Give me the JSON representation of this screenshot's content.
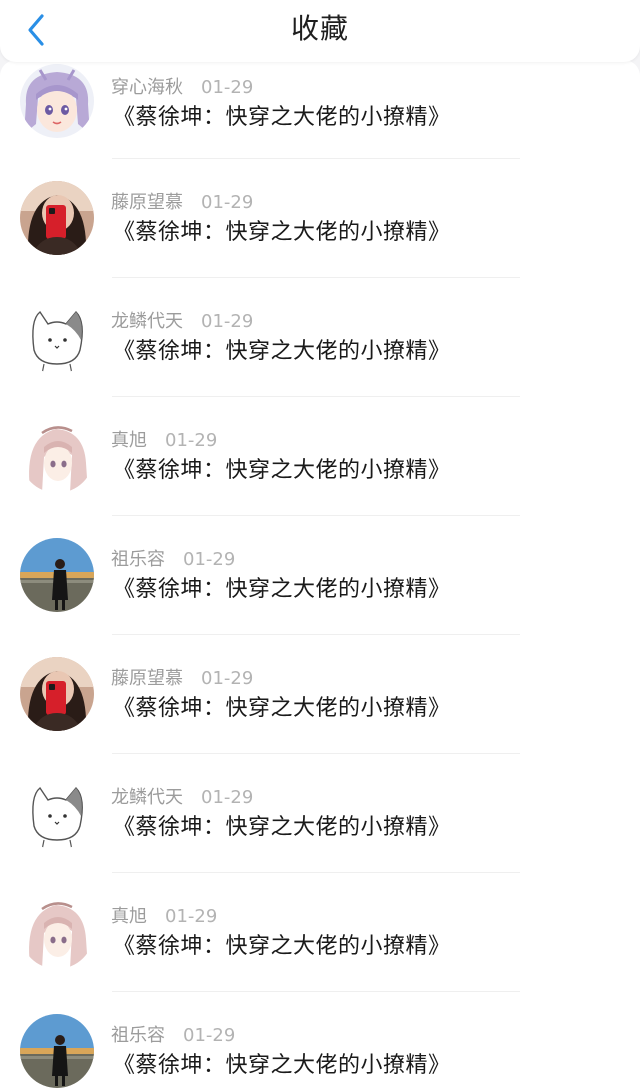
{
  "header": {
    "title": "收藏"
  },
  "items": [
    {
      "username": "穿心海秋",
      "date": "01-29",
      "post": "《蔡徐坤：快穿之大佬的小撩精》",
      "avatar": "anime-purple-hair"
    },
    {
      "username": "藤原望慕",
      "date": "01-29",
      "post": "《蔡徐坤：快穿之大佬的小撩精》",
      "avatar": "selfie-red-phone"
    },
    {
      "username": "龙鳞代天",
      "date": "01-29",
      "post": "《蔡徐坤：快穿之大佬的小撩精》",
      "avatar": "cat-drawing"
    },
    {
      "username": "真旭",
      "date": "01-29",
      "post": "《蔡徐坤：快穿之大佬的小撩精》",
      "avatar": "anime-pink-hair"
    },
    {
      "username": "祖乐容",
      "date": "01-29",
      "post": "《蔡徐坤：快穿之大佬的小撩精》",
      "avatar": "girl-by-sea"
    },
    {
      "username": "藤原望慕",
      "date": "01-29",
      "post": "《蔡徐坤：快穿之大佬的小撩精》",
      "avatar": "selfie-red-phone"
    },
    {
      "username": "龙鳞代天",
      "date": "01-29",
      "post": "《蔡徐坤：快穿之大佬的小撩精》",
      "avatar": "cat-drawing"
    },
    {
      "username": "真旭",
      "date": "01-29",
      "post": "《蔡徐坤：快穿之大佬的小撩精》",
      "avatar": "anime-pink-hair"
    },
    {
      "username": "祖乐容",
      "date": "01-29",
      "post": "《蔡徐坤：快穿之大佬的小撩精》",
      "avatar": "girl-by-sea"
    }
  ],
  "colors": {
    "accent": "#2a8fe6",
    "title_text": "#1f1f1f",
    "meta_text": "#9c9c9c",
    "post_text": "#1a1a1a"
  }
}
